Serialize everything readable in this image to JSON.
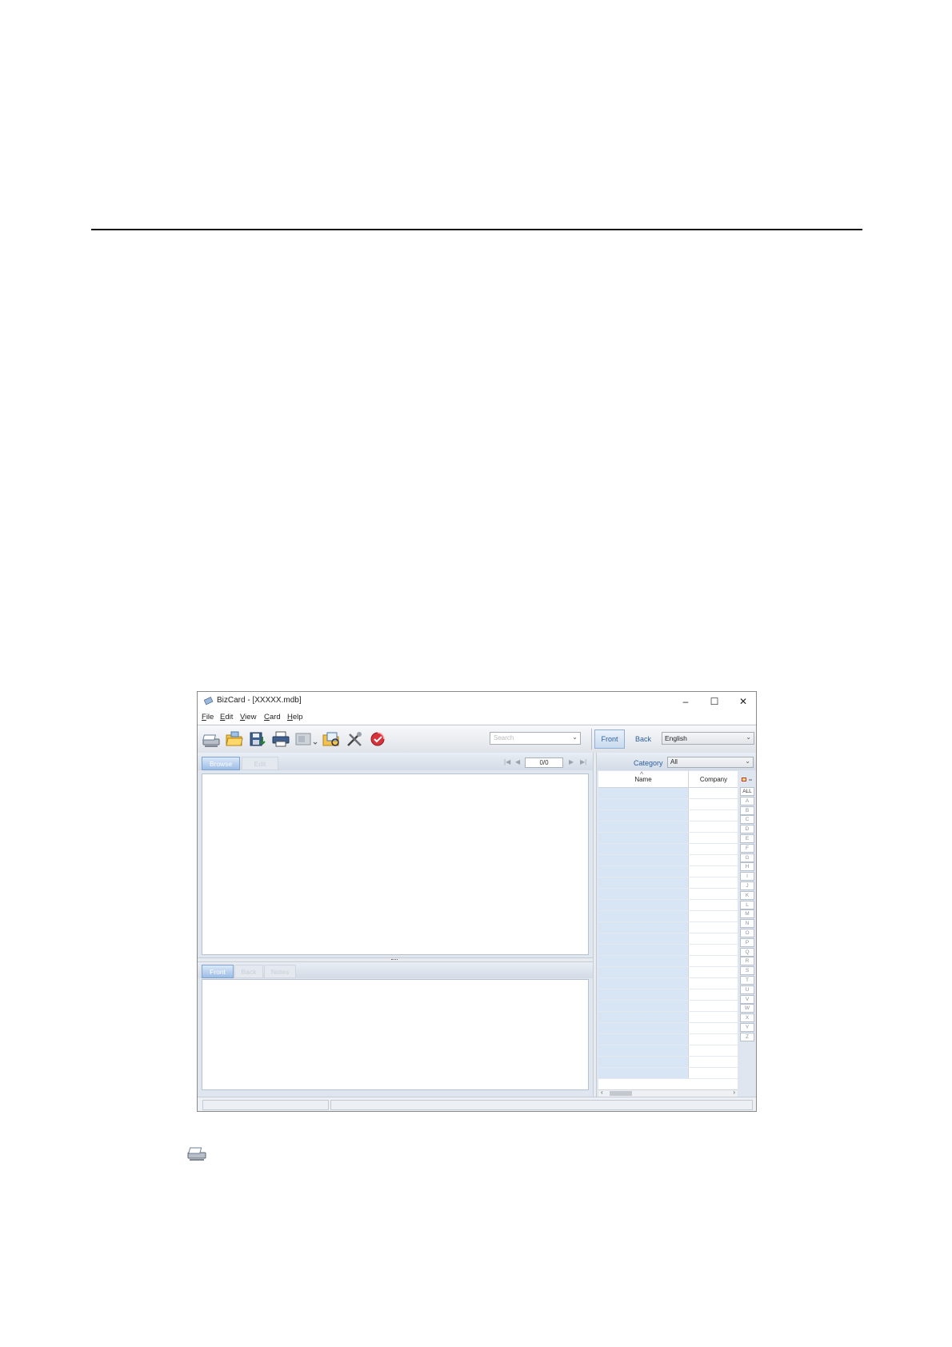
{
  "window": {
    "title": "BizCard - [XXXXX.mdb]",
    "controls": {
      "minimize": "–",
      "maximize": "☐",
      "close": "✕"
    }
  },
  "menu": [
    "File",
    "Edit",
    "View",
    "Card",
    "Help"
  ],
  "toolbar": {
    "icons": [
      "scan-icon",
      "open-folder-icon",
      "save-icon",
      "print-icon",
      "export-icon",
      "image-folder-icon",
      "tools-icon",
      "support-icon"
    ],
    "search_placeholder": "Search",
    "front_label": "Front",
    "back_label": "Back",
    "language": "English"
  },
  "top_tabs": {
    "browse": "Browse",
    "edit": "Edit"
  },
  "navigation": {
    "counter": "0/0",
    "first": "|◀",
    "prev": "◀",
    "next": "▶",
    "last": "▶|"
  },
  "card_tabs": {
    "front": "Front",
    "back": "Back",
    "notes": "Notes"
  },
  "category": {
    "label": "Category",
    "value": "All"
  },
  "grid": {
    "columns": [
      "Name",
      "Company"
    ],
    "sort_indicator": "^",
    "row_count": 26
  },
  "alphabet_index": [
    "ALL",
    "A",
    "B",
    "C",
    "D",
    "E",
    "F",
    "G",
    "H",
    "I",
    "J",
    "K",
    "L",
    "M",
    "N",
    "O",
    "P",
    "Q",
    "R",
    "S",
    "T",
    "U",
    "V",
    "W",
    "X",
    "Y",
    "Z"
  ],
  "colors": {
    "accent": "#2e5f9c",
    "tab_active": "#9dbde5",
    "name_column_bg": "#d7e5f5"
  }
}
